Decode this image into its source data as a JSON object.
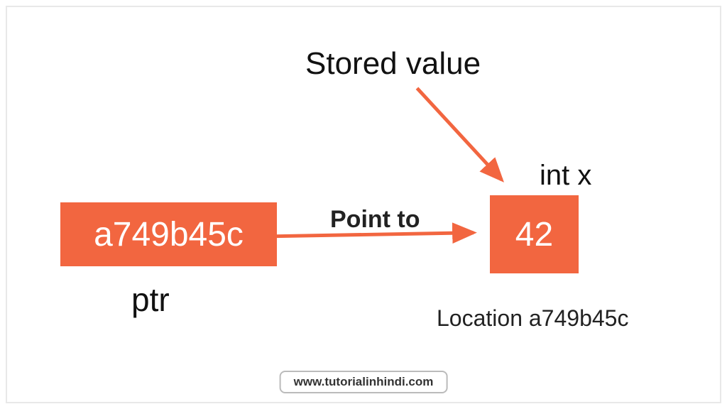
{
  "diagram": {
    "stored_value_label": "Stored value",
    "int_x_label": "int x",
    "pointer_value": "a749b45c",
    "stored_value": "42",
    "point_to_label": "Point to",
    "ptr_label": "ptr",
    "location_label": "Location a749b45c"
  },
  "watermark": "www.tutorialinhindi.com",
  "colors": {
    "box_bg": "#f26640",
    "arrow": "#f26640"
  }
}
